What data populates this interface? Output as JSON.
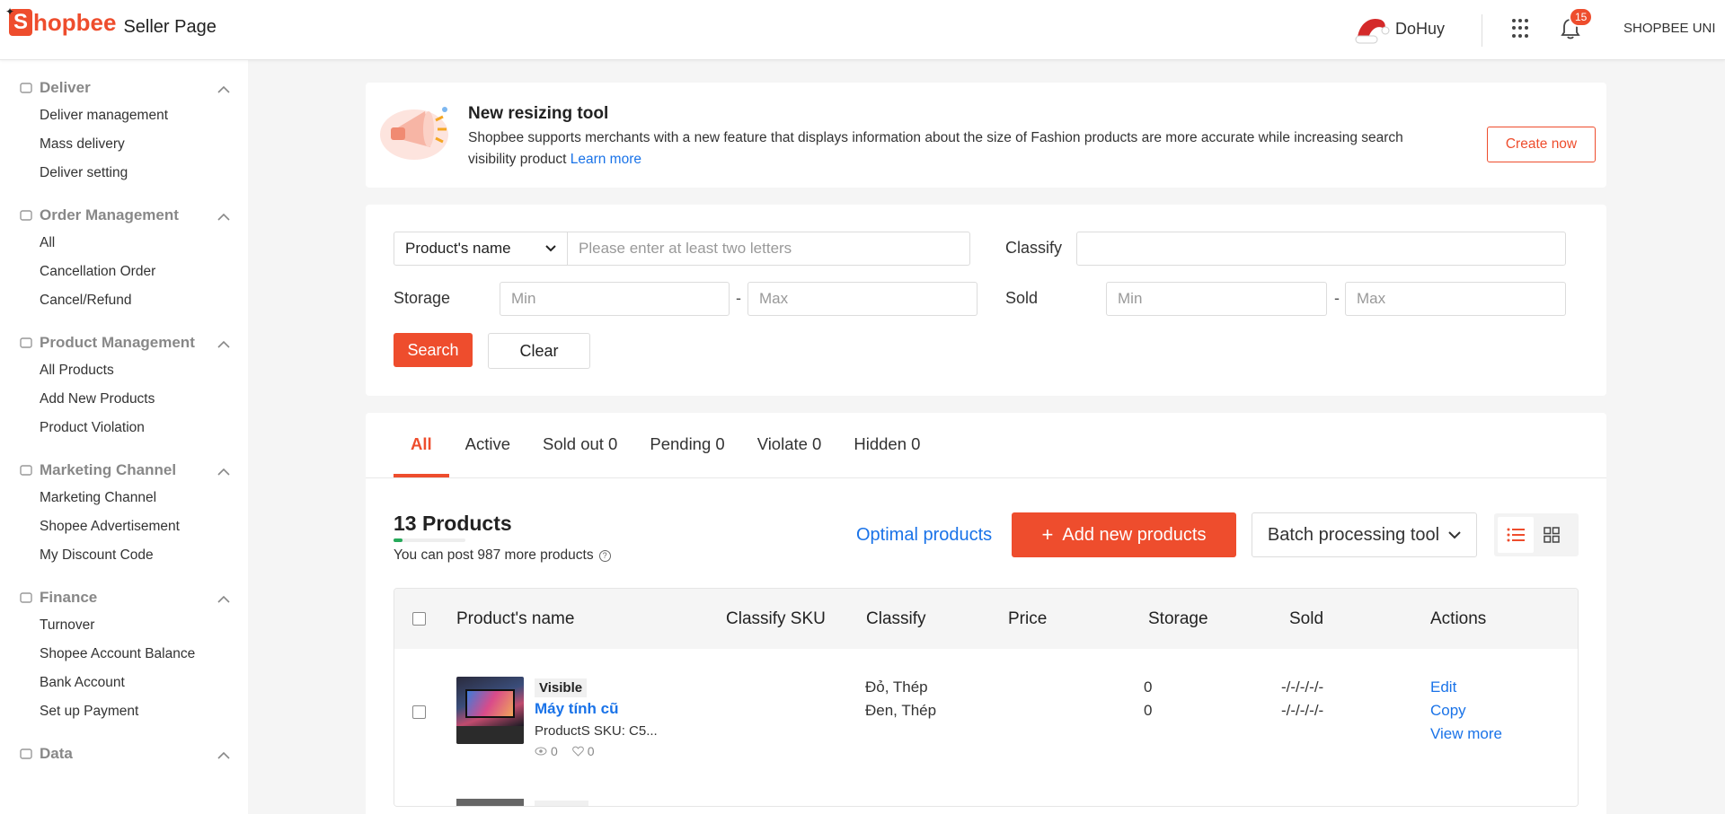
{
  "header": {
    "logo_letter": "S",
    "logo_text": "hopbee",
    "logo_sub": "Seller Page",
    "username": "DoHuy",
    "notification_count": "15",
    "shop_name": "SHOPBEE UNI"
  },
  "sidebar": {
    "sections": [
      {
        "title": "Deliver",
        "icon": "rocket-icon",
        "items": [
          "Deliver management",
          "Mass delivery",
          "Deliver setting"
        ]
      },
      {
        "title": "Order Management",
        "icon": "inbox-icon",
        "items": [
          "All",
          "Cancellation Order",
          "Cancel/Refund"
        ]
      },
      {
        "title": "Product Management",
        "icon": "box-icon",
        "items": [
          "All Products",
          "Add New Products",
          "Product Violation"
        ]
      },
      {
        "title": "Marketing Channel",
        "icon": "flag-icon",
        "items": [
          "Marketing Channel",
          "Shopee Advertisement",
          "My Discount Code"
        ]
      },
      {
        "title": "Finance",
        "icon": "money-icon",
        "items": [
          "Turnover",
          "Shopee Account Balance",
          "Bank Account",
          "Set up Payment"
        ]
      },
      {
        "title": "Data",
        "icon": "chart-icon",
        "items": []
      }
    ]
  },
  "banner": {
    "title": "New resizing tool",
    "description": "Shopbee supports merchants with a new feature that displays information about the size of Fashion products are more accurate while increasing search visibility product",
    "learn_more": "Learn more",
    "create_button": "Create now"
  },
  "filter": {
    "select_value": "Product's name",
    "name_placeholder": "Please enter at least two letters",
    "classify_label": "Classify",
    "storage_label": "Storage",
    "sold_label": "Sold",
    "min_placeholder": "Min",
    "max_placeholder": "Max",
    "dash": "-",
    "search_button": "Search",
    "clear_button": "Clear"
  },
  "tabs": [
    "All",
    "Active",
    "Sold out 0",
    "Pending 0",
    "Violate 0",
    "Hidden 0"
  ],
  "products": {
    "count_label": "13 Products",
    "post_more": "You can post 987 more products",
    "post_progress_percent": 1.3,
    "optimal_link": "Optimal products",
    "add_button": "Add new products",
    "add_button_icon": "+",
    "batch_button": "Batch processing tool"
  },
  "table": {
    "headers": [
      "Product's name",
      "Classify SKU",
      "Classify",
      "Price",
      "Storage",
      "Sold",
      "Actions"
    ],
    "rows": [
      {
        "status": "Visible",
        "name": "Máy tính cũ",
        "sku": "ProductS SKU: C5...",
        "views": "0",
        "likes": "0",
        "classify": [
          "Đỏ, Thép",
          "Đen, Thép"
        ],
        "storage": [
          "0",
          "0"
        ],
        "sold": [
          "-/-/-/-/-",
          "-/-/-/-/-"
        ],
        "actions": [
          "Edit",
          "Copy",
          "View more"
        ]
      }
    ]
  },
  "colors": {
    "accent": "#ee4d2d",
    "link": "#1a73e8",
    "progress": "#26aa5a"
  }
}
